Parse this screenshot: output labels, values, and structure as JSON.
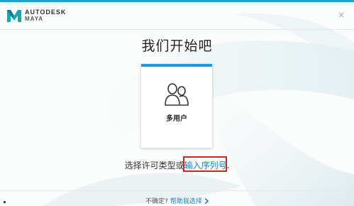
{
  "header": {
    "brand": "AUTODESK",
    "product": "MAYA",
    "logo_icon": "maya-logo-icon",
    "close_label": "×"
  },
  "main": {
    "title": "我们开始吧",
    "card": {
      "label": "多用户",
      "icon": "users-icon",
      "accent_color": "#1a9be0"
    },
    "license_prefix": "选择许可类型或",
    "serial_link": "输入序列号",
    "license_suffix": "."
  },
  "footer": {
    "prompt": "不确定?",
    "help_link": "帮助我选择",
    "chevron_icon": "chevron-right-icon"
  },
  "colors": {
    "accent": "#1a9be0",
    "link": "#1a7fc4",
    "highlight": "#d9201c"
  }
}
